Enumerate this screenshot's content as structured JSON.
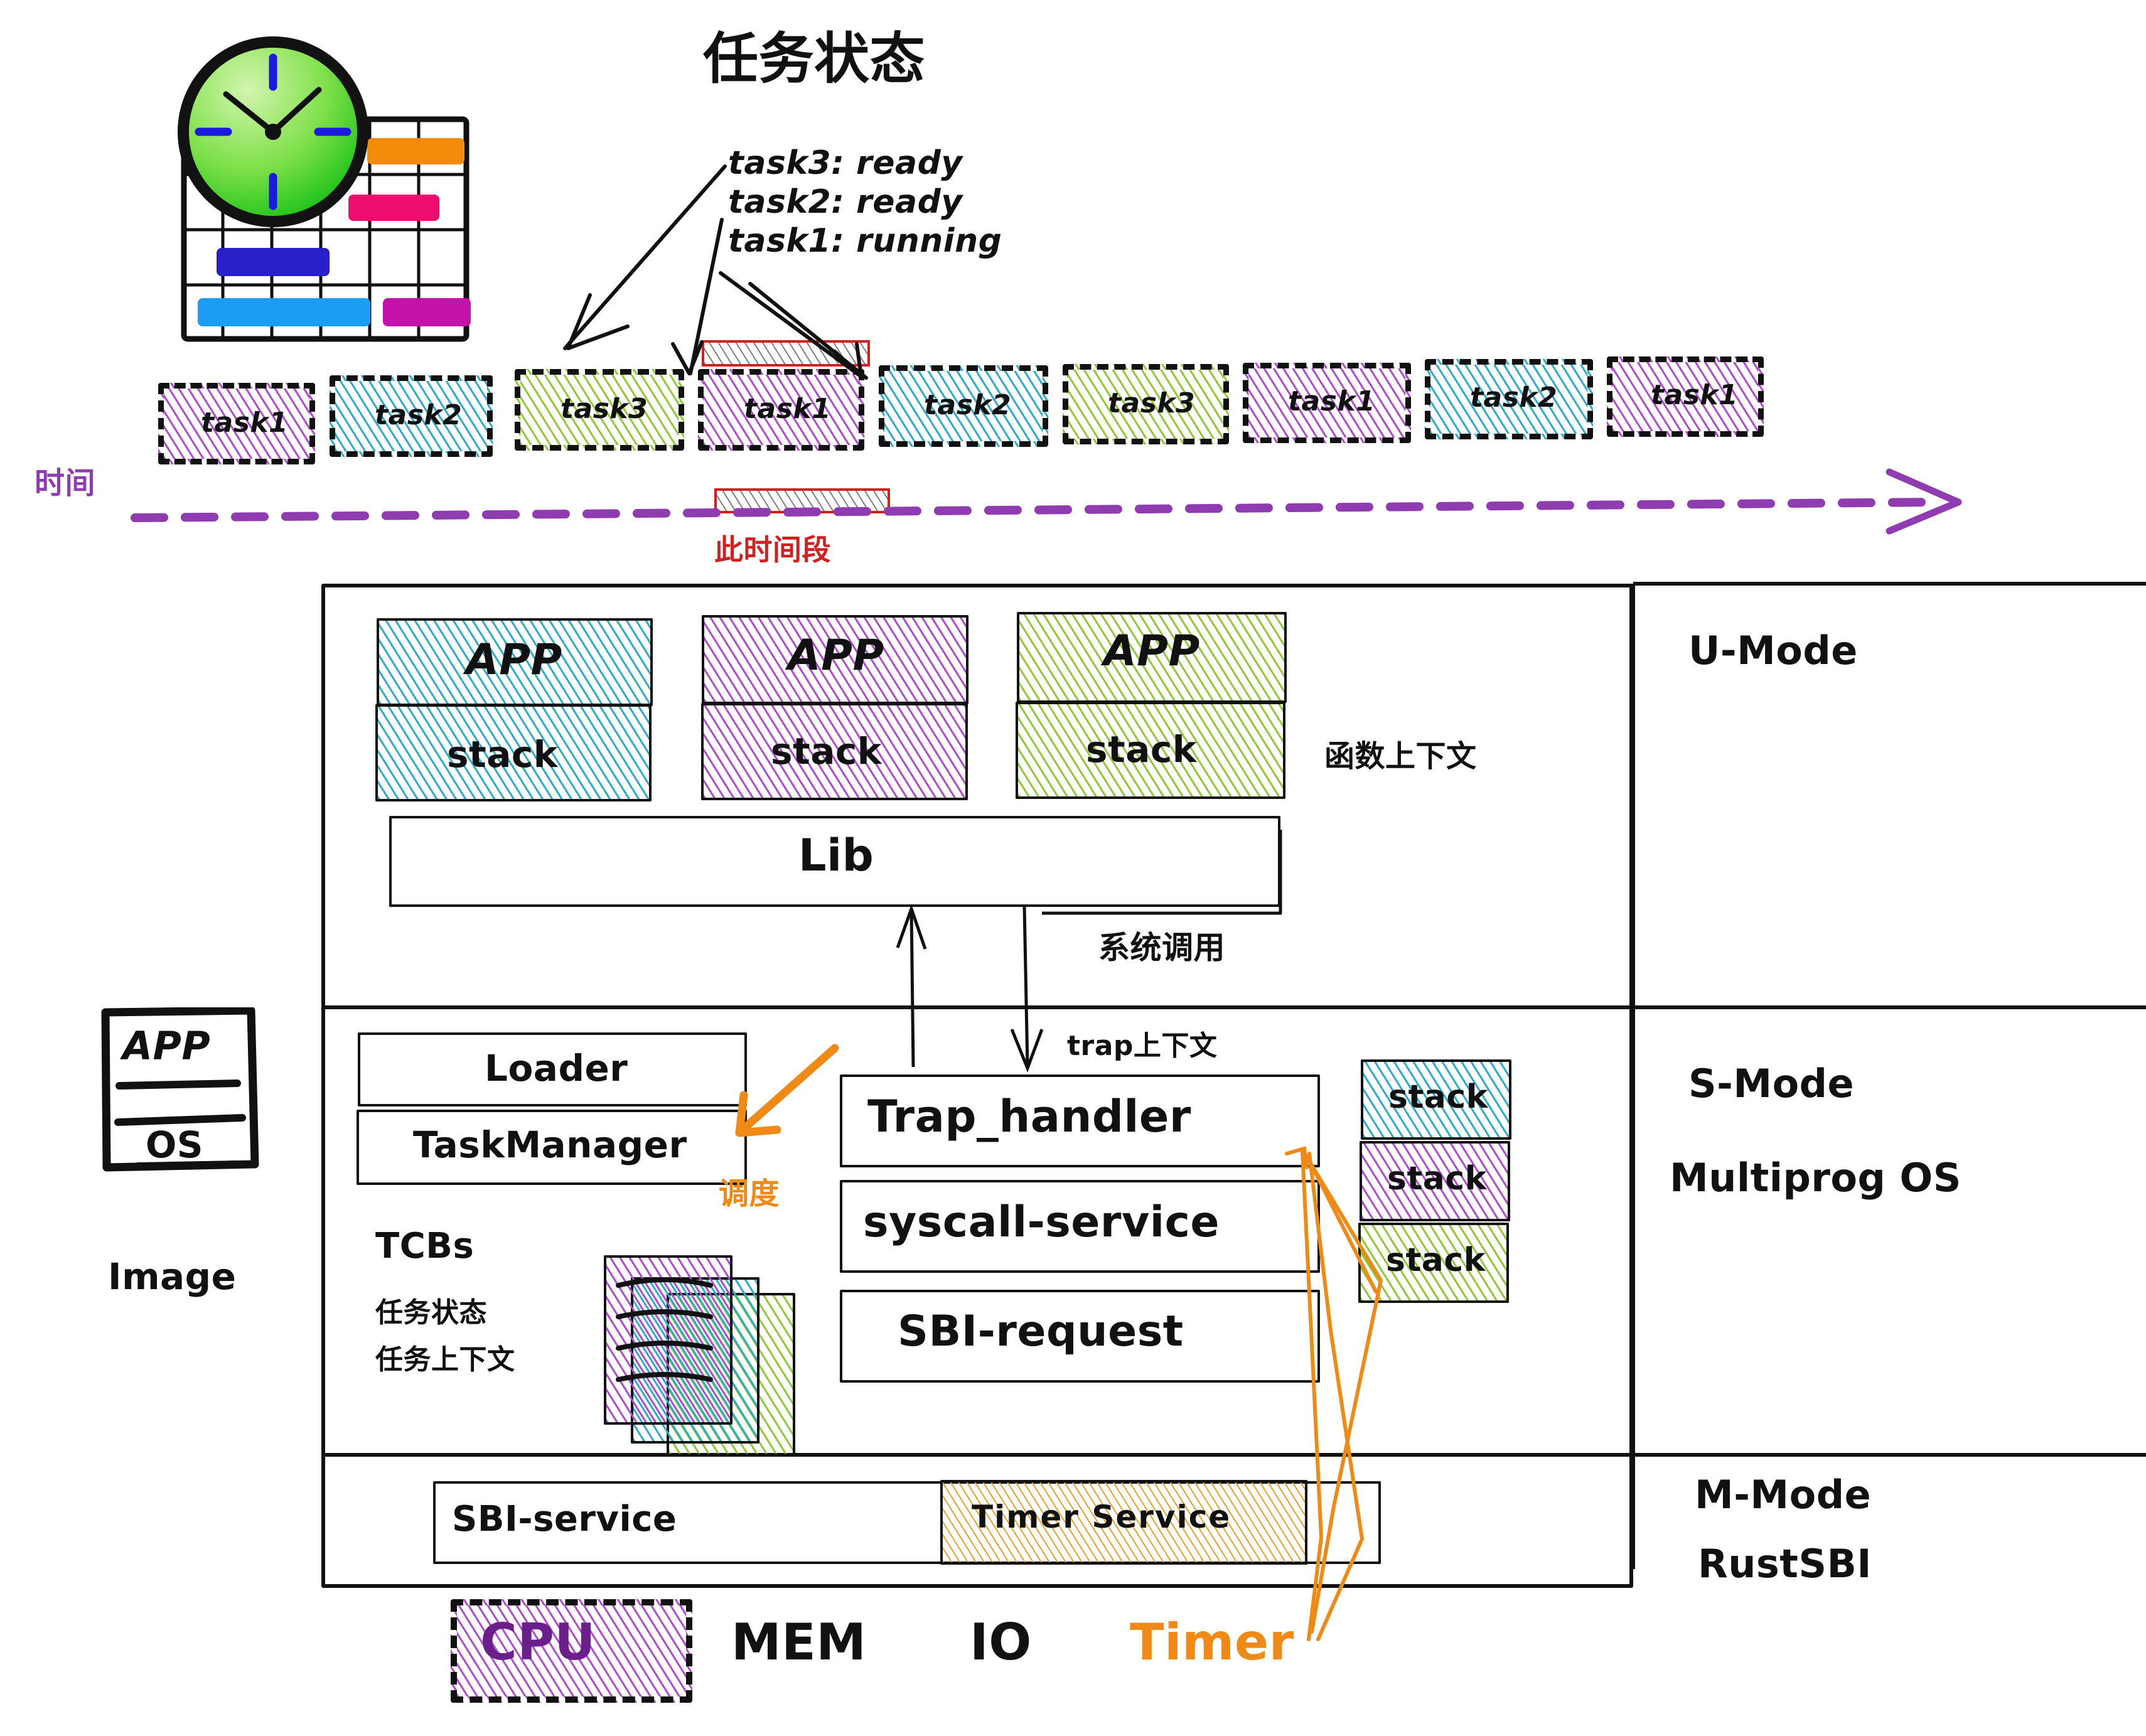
{
  "title": "任务状态",
  "task_states": [
    "task3: ready",
    "task2: ready",
    "task1: running"
  ],
  "timeline": {
    "axis_label": "时间",
    "highlight_label": "此时间段",
    "slices": [
      {
        "label": "task1",
        "color": "purple"
      },
      {
        "label": "task2",
        "color": "cyan"
      },
      {
        "label": "task3",
        "color": "green"
      },
      {
        "label": "task1",
        "color": "purple"
      },
      {
        "label": "task2",
        "color": "cyan"
      },
      {
        "label": "task3",
        "color": "green"
      },
      {
        "label": "task1",
        "color": "purple"
      },
      {
        "label": "task2",
        "color": "cyan"
      },
      {
        "label": "task1",
        "color": "purple"
      }
    ]
  },
  "image_box": {
    "app_label": "APP",
    "os_label": "OS",
    "caption": "Image"
  },
  "modes": {
    "u_mode": "U-Mode",
    "s_mode": "S-Mode",
    "s_mode_os": "Multiprog OS",
    "m_mode": "M-Mode",
    "m_mode_os": "RustSBI"
  },
  "u_mode": {
    "apps": [
      {
        "app": "APP",
        "stack": "stack",
        "color": "cyan"
      },
      {
        "app": "APP",
        "stack": "stack",
        "color": "purple"
      },
      {
        "app": "APP",
        "stack": "stack",
        "color": "green"
      }
    ],
    "lib": "Lib",
    "annotation_func_ctx": "函数上下文",
    "annotation_syscall": "系统调用"
  },
  "s_mode": {
    "loader": "Loader",
    "task_manager": "TaskManager",
    "schedule_label": "调度",
    "tcbs_title": "TCBs",
    "tcbs_lines": [
      "任务状态",
      "任务上下文"
    ],
    "trap_handler": "Trap_handler",
    "syscall_service": "syscall-service",
    "sbi_request": "SBI-request",
    "annotation_trap_ctx": "trap上下文",
    "kernel_stacks": [
      {
        "label": "stack",
        "color": "cyan"
      },
      {
        "label": "stack",
        "color": "purple"
      },
      {
        "label": "stack",
        "color": "green"
      }
    ]
  },
  "m_mode": {
    "sbi_service": "SBI-service",
    "timer_service": "Timer Service"
  },
  "hardware": [
    "CPU",
    "MEM",
    "IO",
    "Timer"
  ],
  "colors": {
    "purple": "#b347d6",
    "cyan": "#29adc9",
    "green": "#8ecb33",
    "orange": "#ef8a17",
    "red": "#d02020",
    "timeline_purple": "#8e3cb0",
    "black": "#111111"
  }
}
